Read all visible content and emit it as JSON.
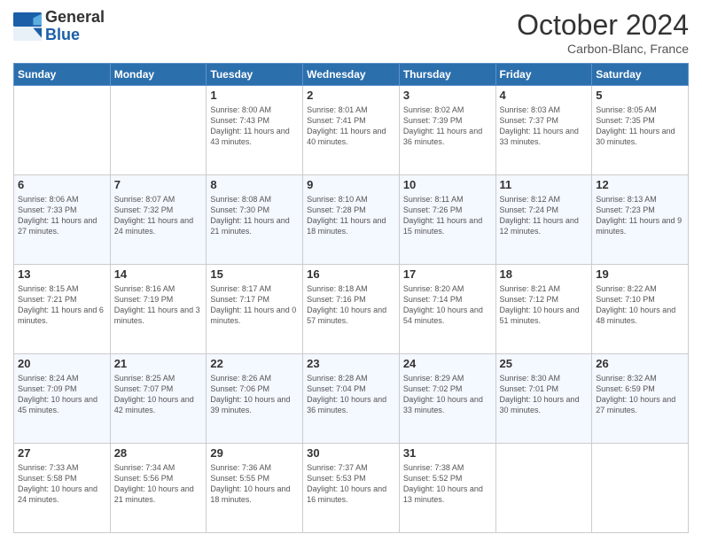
{
  "header": {
    "logo_general": "General",
    "logo_blue": "Blue",
    "month": "October 2024",
    "location": "Carbon-Blanc, France"
  },
  "days_of_week": [
    "Sunday",
    "Monday",
    "Tuesday",
    "Wednesday",
    "Thursday",
    "Friday",
    "Saturday"
  ],
  "weeks": [
    [
      {
        "day": "",
        "info": ""
      },
      {
        "day": "",
        "info": ""
      },
      {
        "day": "1",
        "info": "Sunrise: 8:00 AM\nSunset: 7:43 PM\nDaylight: 11 hours and 43 minutes."
      },
      {
        "day": "2",
        "info": "Sunrise: 8:01 AM\nSunset: 7:41 PM\nDaylight: 11 hours and 40 minutes."
      },
      {
        "day": "3",
        "info": "Sunrise: 8:02 AM\nSunset: 7:39 PM\nDaylight: 11 hours and 36 minutes."
      },
      {
        "day": "4",
        "info": "Sunrise: 8:03 AM\nSunset: 7:37 PM\nDaylight: 11 hours and 33 minutes."
      },
      {
        "day": "5",
        "info": "Sunrise: 8:05 AM\nSunset: 7:35 PM\nDaylight: 11 hours and 30 minutes."
      }
    ],
    [
      {
        "day": "6",
        "info": "Sunrise: 8:06 AM\nSunset: 7:33 PM\nDaylight: 11 hours and 27 minutes."
      },
      {
        "day": "7",
        "info": "Sunrise: 8:07 AM\nSunset: 7:32 PM\nDaylight: 11 hours and 24 minutes."
      },
      {
        "day": "8",
        "info": "Sunrise: 8:08 AM\nSunset: 7:30 PM\nDaylight: 11 hours and 21 minutes."
      },
      {
        "day": "9",
        "info": "Sunrise: 8:10 AM\nSunset: 7:28 PM\nDaylight: 11 hours and 18 minutes."
      },
      {
        "day": "10",
        "info": "Sunrise: 8:11 AM\nSunset: 7:26 PM\nDaylight: 11 hours and 15 minutes."
      },
      {
        "day": "11",
        "info": "Sunrise: 8:12 AM\nSunset: 7:24 PM\nDaylight: 11 hours and 12 minutes."
      },
      {
        "day": "12",
        "info": "Sunrise: 8:13 AM\nSunset: 7:23 PM\nDaylight: 11 hours and 9 minutes."
      }
    ],
    [
      {
        "day": "13",
        "info": "Sunrise: 8:15 AM\nSunset: 7:21 PM\nDaylight: 11 hours and 6 minutes."
      },
      {
        "day": "14",
        "info": "Sunrise: 8:16 AM\nSunset: 7:19 PM\nDaylight: 11 hours and 3 minutes."
      },
      {
        "day": "15",
        "info": "Sunrise: 8:17 AM\nSunset: 7:17 PM\nDaylight: 11 hours and 0 minutes."
      },
      {
        "day": "16",
        "info": "Sunrise: 8:18 AM\nSunset: 7:16 PM\nDaylight: 10 hours and 57 minutes."
      },
      {
        "day": "17",
        "info": "Sunrise: 8:20 AM\nSunset: 7:14 PM\nDaylight: 10 hours and 54 minutes."
      },
      {
        "day": "18",
        "info": "Sunrise: 8:21 AM\nSunset: 7:12 PM\nDaylight: 10 hours and 51 minutes."
      },
      {
        "day": "19",
        "info": "Sunrise: 8:22 AM\nSunset: 7:10 PM\nDaylight: 10 hours and 48 minutes."
      }
    ],
    [
      {
        "day": "20",
        "info": "Sunrise: 8:24 AM\nSunset: 7:09 PM\nDaylight: 10 hours and 45 minutes."
      },
      {
        "day": "21",
        "info": "Sunrise: 8:25 AM\nSunset: 7:07 PM\nDaylight: 10 hours and 42 minutes."
      },
      {
        "day": "22",
        "info": "Sunrise: 8:26 AM\nSunset: 7:06 PM\nDaylight: 10 hours and 39 minutes."
      },
      {
        "day": "23",
        "info": "Sunrise: 8:28 AM\nSunset: 7:04 PM\nDaylight: 10 hours and 36 minutes."
      },
      {
        "day": "24",
        "info": "Sunrise: 8:29 AM\nSunset: 7:02 PM\nDaylight: 10 hours and 33 minutes."
      },
      {
        "day": "25",
        "info": "Sunrise: 8:30 AM\nSunset: 7:01 PM\nDaylight: 10 hours and 30 minutes."
      },
      {
        "day": "26",
        "info": "Sunrise: 8:32 AM\nSunset: 6:59 PM\nDaylight: 10 hours and 27 minutes."
      }
    ],
    [
      {
        "day": "27",
        "info": "Sunrise: 7:33 AM\nSunset: 5:58 PM\nDaylight: 10 hours and 24 minutes."
      },
      {
        "day": "28",
        "info": "Sunrise: 7:34 AM\nSunset: 5:56 PM\nDaylight: 10 hours and 21 minutes."
      },
      {
        "day": "29",
        "info": "Sunrise: 7:36 AM\nSunset: 5:55 PM\nDaylight: 10 hours and 18 minutes."
      },
      {
        "day": "30",
        "info": "Sunrise: 7:37 AM\nSunset: 5:53 PM\nDaylight: 10 hours and 16 minutes."
      },
      {
        "day": "31",
        "info": "Sunrise: 7:38 AM\nSunset: 5:52 PM\nDaylight: 10 hours and 13 minutes."
      },
      {
        "day": "",
        "info": ""
      },
      {
        "day": "",
        "info": ""
      }
    ]
  ]
}
